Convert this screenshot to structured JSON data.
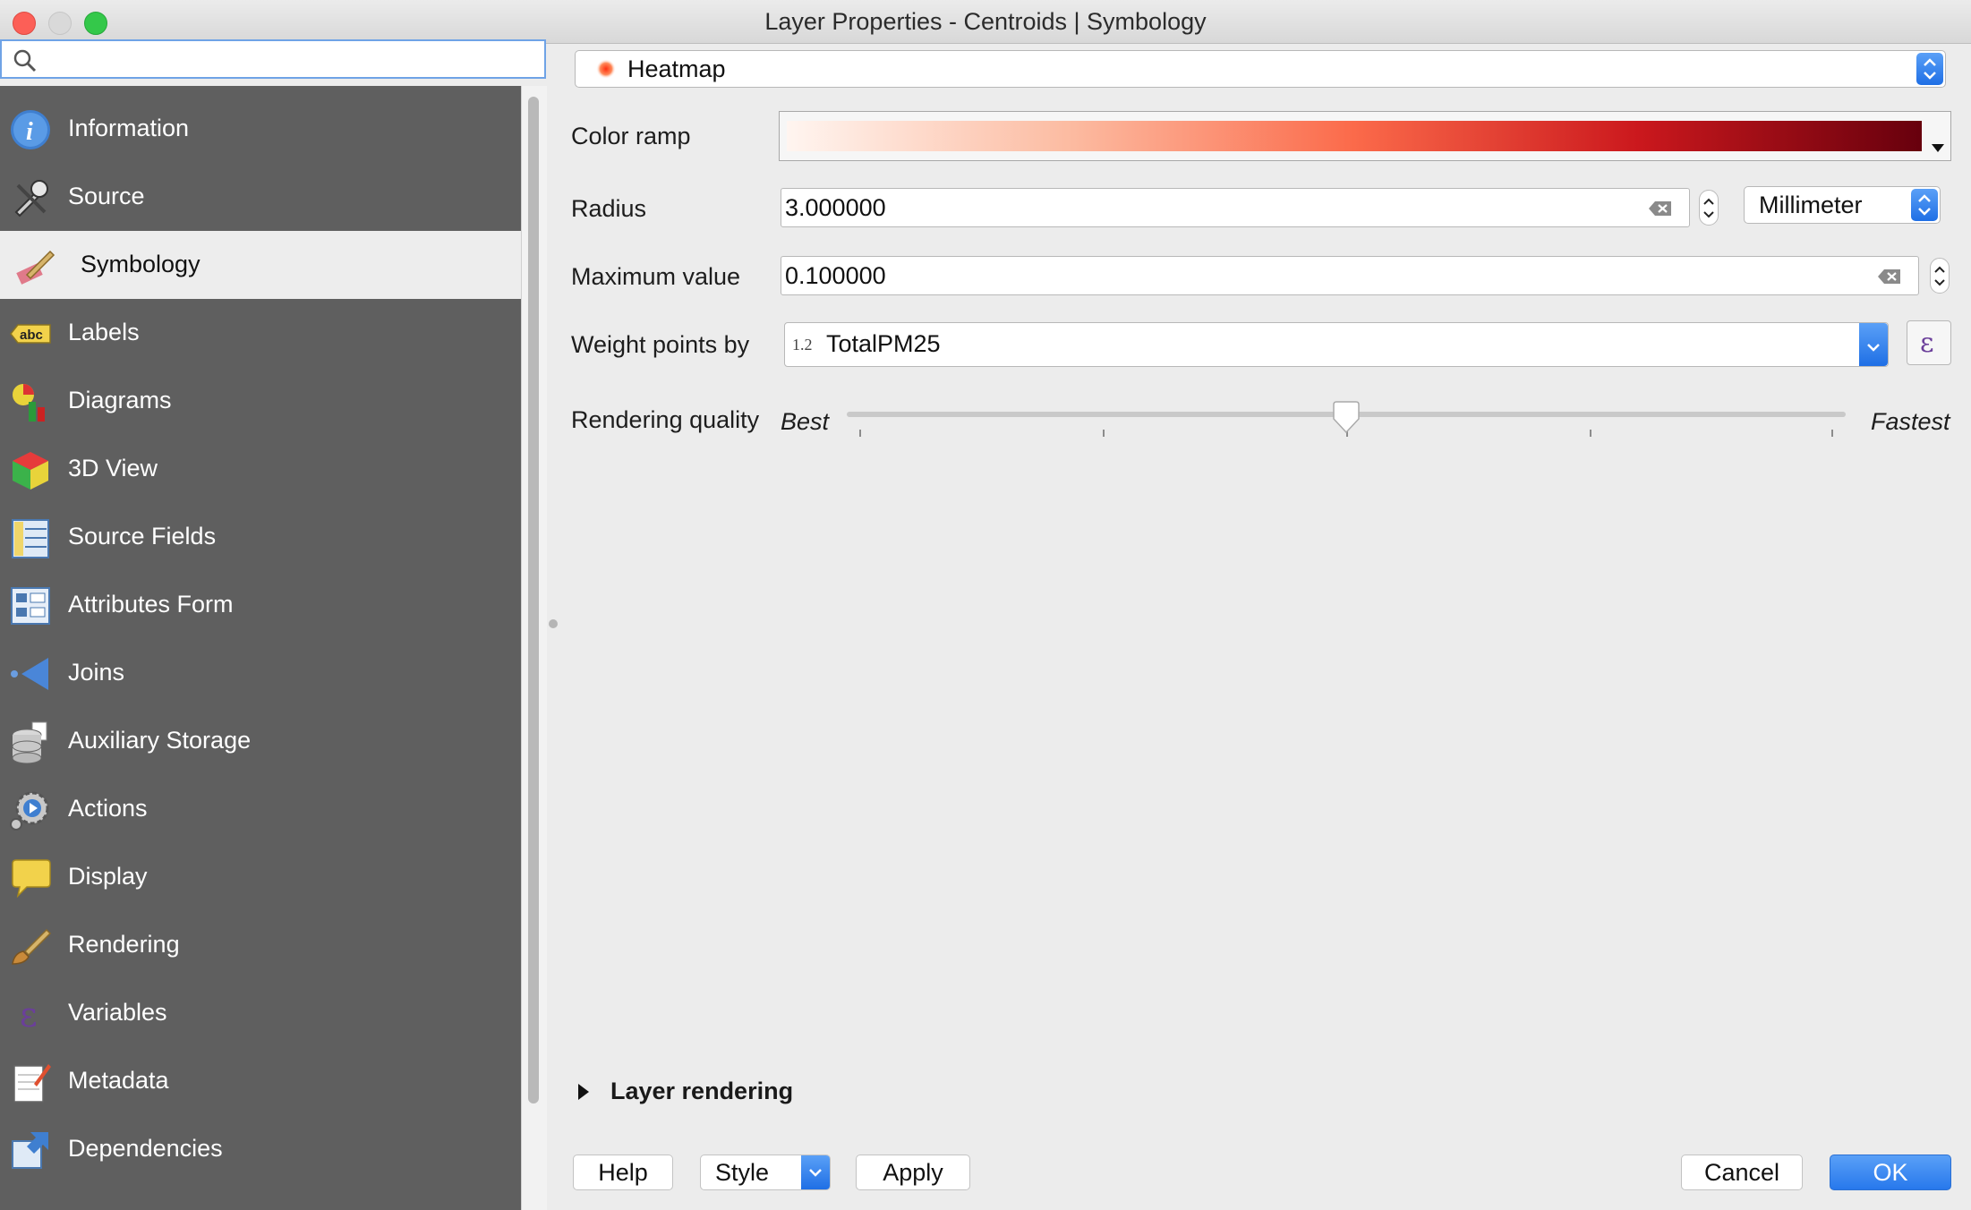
{
  "window": {
    "title": "Layer Properties - Centroids | Symbology"
  },
  "search": {
    "placeholder": ""
  },
  "sidebar": {
    "items": [
      {
        "label": "Information",
        "icon": "info-icon"
      },
      {
        "label": "Source",
        "icon": "wrench-icon"
      },
      {
        "label": "Symbology",
        "icon": "paintbrush-icon",
        "selected": true
      },
      {
        "label": "Labels",
        "icon": "abc-label-icon"
      },
      {
        "label": "Diagrams",
        "icon": "diagram-icon"
      },
      {
        "label": "3D View",
        "icon": "cube-icon"
      },
      {
        "label": "Source Fields",
        "icon": "fields-icon"
      },
      {
        "label": "Attributes Form",
        "icon": "form-icon"
      },
      {
        "label": "Joins",
        "icon": "join-icon"
      },
      {
        "label": "Auxiliary Storage",
        "icon": "database-icon"
      },
      {
        "label": "Actions",
        "icon": "gear-play-icon"
      },
      {
        "label": "Display",
        "icon": "speech-bubble-icon"
      },
      {
        "label": "Rendering",
        "icon": "brush-icon"
      },
      {
        "label": "Variables",
        "icon": "epsilon-icon"
      },
      {
        "label": "Metadata",
        "icon": "notepad-icon"
      },
      {
        "label": "Dependencies",
        "icon": "dependencies-icon"
      }
    ]
  },
  "renderer": {
    "value": "Heatmap"
  },
  "color_ramp": {
    "label": "Color ramp",
    "colors": [
      "#fff5f0",
      "#fcbba1",
      "#fb6a4a",
      "#cb181d",
      "#67000d"
    ]
  },
  "radius": {
    "label": "Radius",
    "value": "3.000000",
    "unit": "Millimeter"
  },
  "maximum": {
    "label": "Maximum value",
    "value": "0.100000"
  },
  "weight": {
    "label": "Weight points by",
    "type_badge": "1.2",
    "field": "TotalPM25"
  },
  "quality": {
    "label": "Rendering quality",
    "min_label": "Best",
    "max_label": "Fastest",
    "value_fraction": 0.5
  },
  "layer_rendering": {
    "label": "Layer rendering"
  },
  "buttons": {
    "help": "Help",
    "style": "Style",
    "apply": "Apply",
    "cancel": "Cancel",
    "ok": "OK"
  },
  "colors": {
    "accent": "#1f6fe5",
    "sidebar_bg": "#5f5f5f"
  }
}
